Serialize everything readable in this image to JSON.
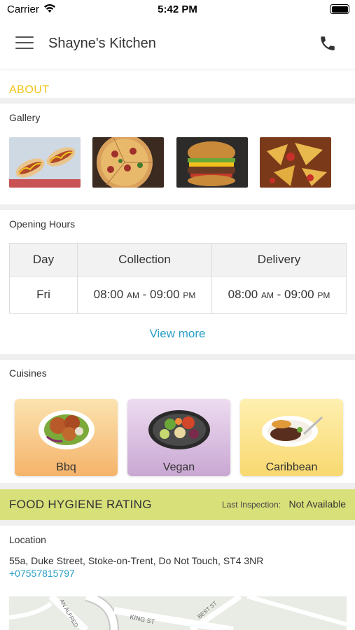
{
  "status_bar": {
    "carrier": "Carrier",
    "time": "5:42 PM"
  },
  "header": {
    "title": "Shayne's Kitchen"
  },
  "about": {
    "label": "ABOUT"
  },
  "gallery": {
    "label": "Gallery",
    "images": [
      {
        "name": "hotdogs-image"
      },
      {
        "name": "pizza-image"
      },
      {
        "name": "burger-image"
      },
      {
        "name": "nachos-image"
      }
    ]
  },
  "opening_hours": {
    "label": "Opening Hours",
    "columns": [
      "Day",
      "Collection",
      "Delivery"
    ],
    "rows": [
      {
        "day": "Fri",
        "collection": "08:00 AM - 09:00 PM",
        "delivery": "08:00 AM - 09:00 PM"
      }
    ],
    "view_more": "View more"
  },
  "cuisines": {
    "label": "Cuisines",
    "items": [
      {
        "label": "Bbq",
        "color_top": "#fbe3b0",
        "color_bottom": "#f5b36a"
      },
      {
        "label": "Vegan",
        "color_top": "#eddcf0",
        "color_bottom": "#c9a7d3"
      },
      {
        "label": "Caribbean",
        "color_top": "#fff0b0",
        "color_bottom": "#f8d870"
      }
    ]
  },
  "hygiene": {
    "title": "FOOD HYGIENE RATING",
    "inspection_label": "Last Inspection:",
    "inspection_value": "Not Available"
  },
  "location": {
    "label": "Location",
    "address": "55a, Duke Street, Stoke-on-Trent, Do Not Touch, ST4 3NR",
    "phone": "+07557815797",
    "map_labels": [
      "KING ST",
      "BEST ST",
      "AN ALFRED"
    ]
  },
  "colors": {
    "accent": "#2a9fc6",
    "about": "#f0c419",
    "hygiene_bg": "#d8e07a"
  }
}
